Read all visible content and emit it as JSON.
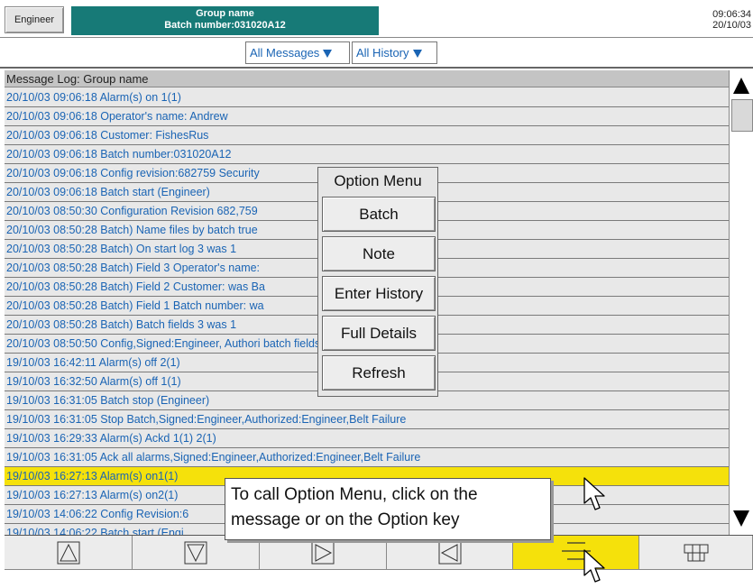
{
  "header": {
    "user_button": "Engineer",
    "group_line": "Group name",
    "batch_line": "Batch number:031020A12",
    "time": "09:06:34",
    "date": "20/10/03",
    "title_color": "#177a77"
  },
  "filters": {
    "messages_label": "All Messages",
    "history_label": "All History"
  },
  "log": {
    "header": "Message Log: Group name",
    "rows": [
      "20/10/03 09:06:18 Alarm(s) on 1(1)",
      "20/10/03 09:06:18 Operator's name: Andrew",
      "20/10/03 09:06:18 Customer: FishesRus",
      "20/10/03 09:06:18 Batch number:031020A12",
      "20/10/03 09:06:18 Config revision:682759 Security",
      "20/10/03 09:06:18 Batch start (Engineer)",
      "20/10/03 08:50:30 Configuration Revision 682,759",
      "20/10/03 08:50:28 Batch) Name files by batch true",
      "20/10/03 08:50:28 Batch) On start log 3 was 1",
      "20/10/03 08:50:28 Batch) Field 3 Operator's name:",
      "20/10/03 08:50:28 Batch) Field 2 Customer: was Ba",
      "20/10/03 08:50:28 Batch) Field 1 Batch number: wa",
      "20/10/03 08:50:28 Batch) Batch fields 3 was 1",
      "20/10/03 08:50:50 Config,Signed:Engineer, Authori                          batch fields",
      "19/10/03 16:42:11 Alarm(s) off 2(1)",
      "19/10/03 16:32:50 Alarm(s) off 1(1)",
      "19/10/03 16:31:05 Batch stop (Engineer)",
      "19/10/03 16:31:05 Stop Batch,Signed:Engineer,Authorized:Engineer,Belt Failure",
      "19/10/03 16:29:33 Alarm(s) Ackd 1(1) 2(1)",
      "19/10/03 16:31:05 Ack all alarms,Signed:Engineer,Authorized:Engineer,Belt Failure",
      "19/10/03 16:27:13 Alarm(s) on1(1)",
      "19/10/03 16:27:13 Alarm(s) on2(1)",
      "19/10/03 14:06:22 Config Revision:6",
      "19/10/03 14:06:22 Batch start (Engi"
    ],
    "selected_index": 20,
    "selected_color": "#f5e10b",
    "text_color": "#1a64b4"
  },
  "option_menu": {
    "title": "Option Menu",
    "items": [
      "Batch",
      "Note",
      "Enter History",
      "Full Details",
      "Refresh"
    ]
  },
  "callout": {
    "line1": "To call Option Menu, click on the",
    "line2": "message or on the Option key"
  },
  "keys": [
    "up-key",
    "down-key",
    "right-key",
    "left-key",
    "option-key",
    "grid-key"
  ]
}
